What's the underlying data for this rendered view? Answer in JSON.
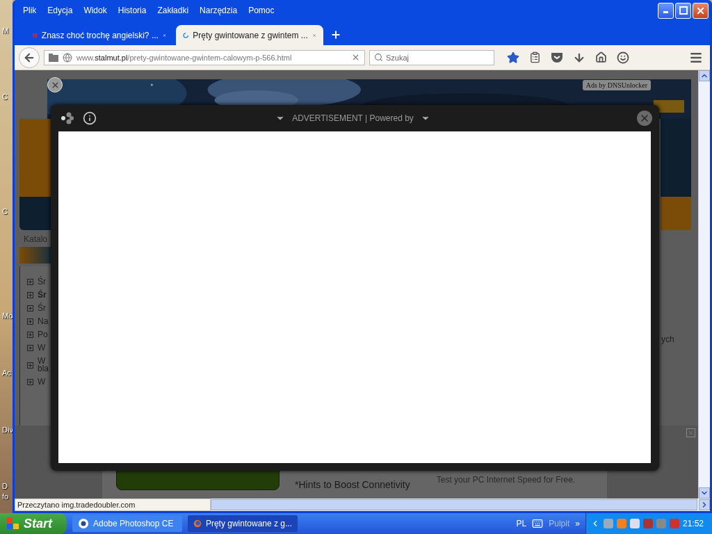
{
  "desktop": {
    "icon_labels": [
      "M",
      "C",
      "C",
      "Mo",
      "Ac",
      "Div",
      "D",
      "fo"
    ]
  },
  "menu": [
    "Plik",
    "Edycja",
    "Widok",
    "Historia",
    "Zakładki",
    "Narzędzia",
    "Pomoc"
  ],
  "tabs": [
    {
      "title": "Znasz choć trochę angielski? ...",
      "selected": false,
      "kind": "page"
    },
    {
      "title": "Pręty gwintowane z gwintem ...",
      "selected": true,
      "kind": "loading"
    }
  ],
  "address": {
    "host_prefix": "www.",
    "host": "stalmut.pl",
    "path": "/prety-gwintowane-gwintem-calowym-p-566.html"
  },
  "search": {
    "placeholder": "Szukaj"
  },
  "bookmarked": true,
  "page": {
    "sidebar_heading": "Katalo",
    "tree_items": [
      {
        "lines": [
          "Śr"
        ],
        "bold": false
      },
      {
        "lines": [
          "Śr"
        ],
        "bold": true
      },
      {
        "lines": [
          "Śr"
        ],
        "bold": false
      },
      {
        "lines": [
          "Na"
        ],
        "bold": false
      },
      {
        "lines": [
          "Po"
        ],
        "bold": false
      },
      {
        "lines": [
          "W"
        ],
        "bold": false
      },
      {
        "lines": [
          "W",
          "bla"
        ],
        "bold": false
      },
      {
        "lines": [
          "W"
        ],
        "bold": false
      }
    ],
    "right_text": "ych",
    "ad_tag": "Ads by DNSUnlocker",
    "bottom_ad": {
      "hint": "*Hints to Boost Connetivity",
      "tagline": "Test your PC Internet Speed for Free."
    }
  },
  "modal": {
    "title": "ADVERTISEMENT | Powered by"
  },
  "status": "Przeczytano img.tradedoubler.com",
  "taskbar": {
    "start": "Start",
    "tasks": [
      {
        "label": "Adobe Photoshop CE",
        "selected": false,
        "kind": "photoshop"
      },
      {
        "label": "Pręty gwintowane z g...",
        "selected": true,
        "kind": "browser"
      }
    ],
    "language": "PL",
    "toolbar": "Pulpit",
    "chevron": "»",
    "clock": "21:52"
  }
}
